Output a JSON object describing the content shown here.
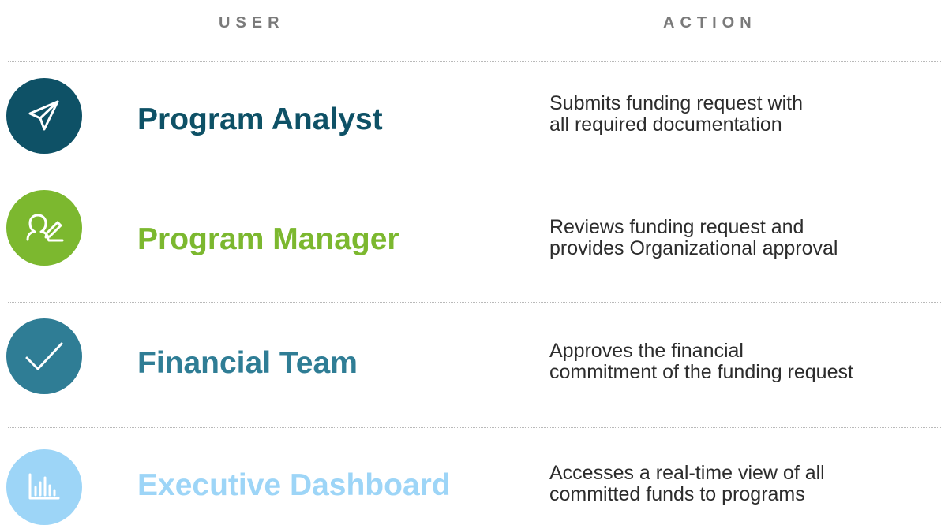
{
  "headers": {
    "user": "USER",
    "action": "ACTION"
  },
  "rows": [
    {
      "role": "Program Analyst",
      "action": "Submits funding request with\nall required documentation",
      "icon": "paper-plane-icon",
      "color": "#0e5166"
    },
    {
      "role": "Program Manager",
      "action": "Reviews funding request and\nprovides Organizational approval",
      "icon": "person-edit-icon",
      "color": "#7cb82f"
    },
    {
      "role": "Financial Team",
      "action": "Approves the financial\ncommitment of the funding request",
      "icon": "checkmark-icon",
      "color": "#2f7d95"
    },
    {
      "role": "Executive Dashboard",
      "action": "Accesses a real-time view of all\ncommitted funds to programs",
      "icon": "bar-chart-icon",
      "color": "#9dd5f7"
    }
  ]
}
